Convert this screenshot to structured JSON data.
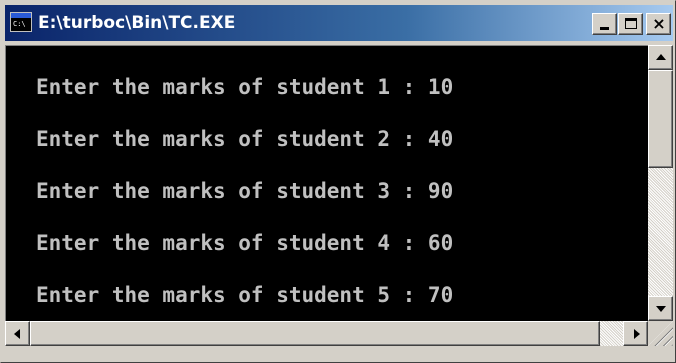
{
  "window": {
    "title": "E:\\turboc\\Bin\\TC.EXE",
    "icon": "console-window-icon",
    "icon_text": "C:\\",
    "controls": {
      "minimize_icon": "minimize-icon",
      "maximize_icon": "maximize-icon",
      "close_icon": "close-icon",
      "close_glyph": "×"
    }
  },
  "console": {
    "background": "#000000",
    "text_color": "#c0c0c0",
    "lines": [
      "Enter the marks of student 1 : 10",
      "Enter the marks of student 2 : 40",
      "Enter the marks of student 3 : 90",
      "Enter the marks of student 4 : 60",
      "Enter the marks of student 5 : 70"
    ]
  },
  "scrollbars": {
    "vertical": {
      "up_icon": "arrow-up-icon",
      "down_icon": "arrow-down-icon"
    },
    "horizontal": {
      "left_icon": "arrow-left-icon",
      "right_icon": "arrow-right-icon"
    }
  },
  "colors": {
    "titlebar_start": "#0a246a",
    "titlebar_end": "#a6caf0",
    "chrome": "#d4d0c8"
  }
}
